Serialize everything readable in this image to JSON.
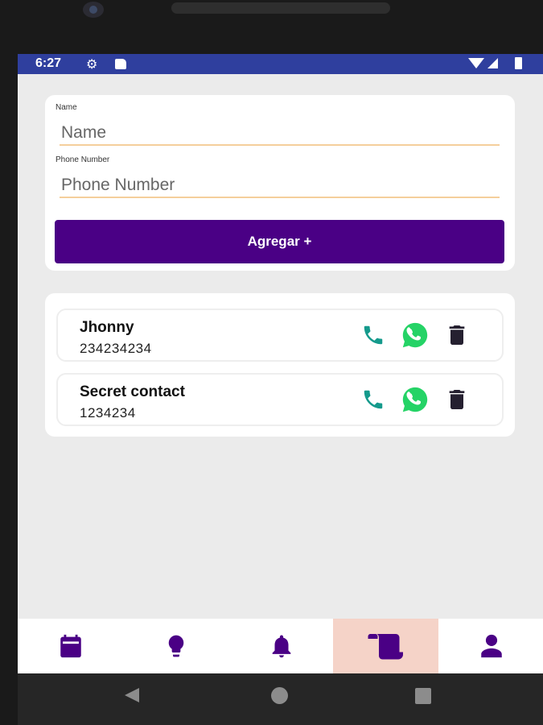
{
  "status_bar": {
    "time": "6:27",
    "icons": [
      "gear-icon",
      "sd-card-icon",
      "wifi-icon",
      "signal-icon",
      "battery-icon"
    ]
  },
  "form": {
    "name_label": "Name",
    "name_placeholder": "Name",
    "name_value": "",
    "phone_label": "Phone Number",
    "phone_placeholder": "Phone Number",
    "phone_value": "",
    "add_button_label": "Agregar +"
  },
  "contacts": [
    {
      "name": "Jhonny",
      "phone": "234234234"
    },
    {
      "name": "Secret contact",
      "phone": "1234234"
    }
  ],
  "contact_actions": [
    "phone-icon",
    "whatsapp-icon",
    "trash-icon"
  ],
  "bottom_nav": {
    "items": [
      {
        "icon": "calendar-icon",
        "active": false
      },
      {
        "icon": "lightbulb-icon",
        "active": false
      },
      {
        "icon": "bell-icon",
        "active": false
      },
      {
        "icon": "scroll-icon",
        "active": true
      },
      {
        "icon": "user-icon",
        "active": false
      }
    ]
  },
  "system_nav": [
    "back-icon",
    "home-icon",
    "recents-icon"
  ],
  "colors": {
    "status_bar": "#2f3f9e",
    "primary": "#4a0085",
    "input_underline": "#f5cf9c",
    "call_icon": "#159a8c",
    "whatsapp": "#25d366",
    "trash": "#252030",
    "nav_icon": "#4a0085",
    "nav_active_bg": "#f5d3c8",
    "screen_bg": "#ebebeb"
  }
}
